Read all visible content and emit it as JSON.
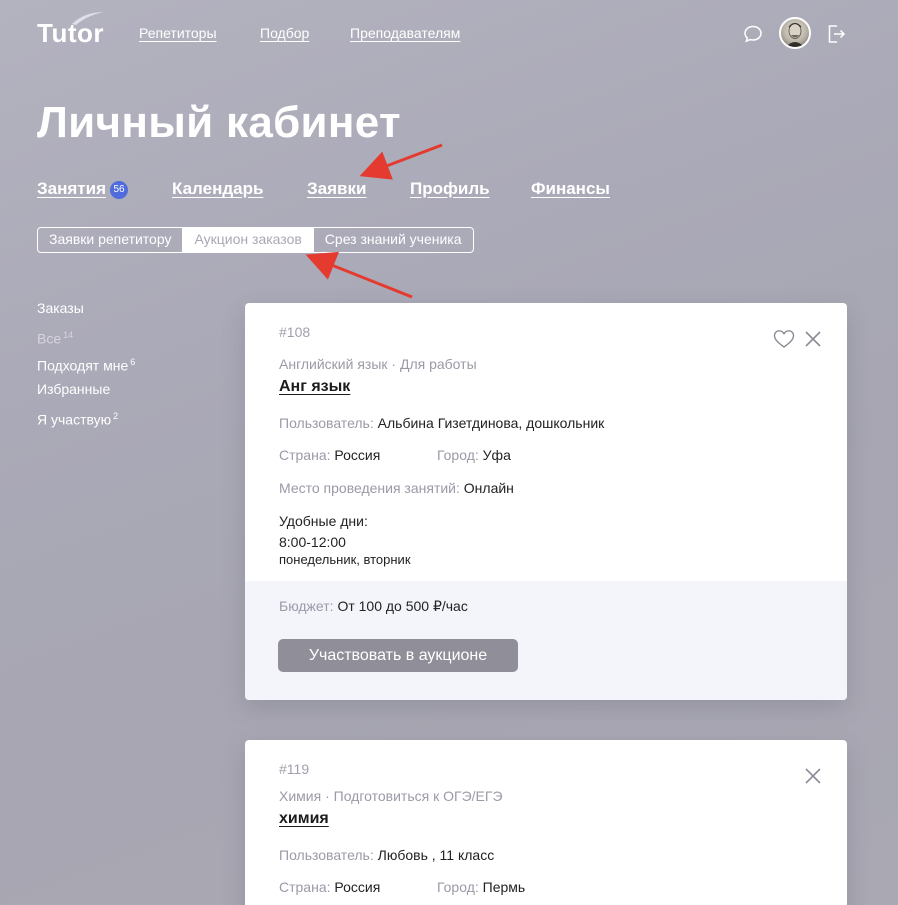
{
  "header": {
    "logo": "Tutor",
    "nav": [
      "Репетиторы",
      "Подбор",
      "Преподавателям"
    ],
    "icons": [
      "chat-icon",
      "avatar",
      "logout-icon"
    ]
  },
  "page": {
    "title": "Личный кабинет"
  },
  "main_tabs": [
    {
      "label": "Занятия",
      "badge": "56"
    },
    {
      "label": "Календарь"
    },
    {
      "label": "Заявки"
    },
    {
      "label": "Профиль"
    },
    {
      "label": "Финансы"
    }
  ],
  "sub_tabs": [
    {
      "label": "Заявки репетитору",
      "active": false
    },
    {
      "label": "Аукцион заказов",
      "active": true
    },
    {
      "label": "Срез знаний ученика",
      "active": false
    }
  ],
  "sidebar": {
    "heading": "Заказы",
    "items": [
      {
        "label": "Все",
        "count": "14"
      },
      {
        "label": "Подходят мне",
        "count": "6"
      },
      {
        "label": "Избранные",
        "count": ""
      },
      {
        "label": "Я участвую",
        "count": "2"
      }
    ]
  },
  "orders": [
    {
      "id": "#108",
      "subject": "Английский язык · Для работы",
      "title": "Анг язык",
      "user_label": "Пользователь:",
      "user": "Альбина Гизетдинова, дошкольник",
      "country_label": "Страна:",
      "country": "Россия",
      "city_label": "Город:",
      "city": "Уфа",
      "place_label": "Место проведения занятий:",
      "place": "Онлайн",
      "days_label": "Удобные дни:",
      "time": "8:00-12:00",
      "days": "понедельник, вторник",
      "budget_label": "Бюджет:",
      "budget": "От 100 до 500 ₽/час",
      "button": "Участвовать в аукционе"
    },
    {
      "id": "#119",
      "subject": "Химия · Подготовиться к ОГЭ/ЕГЭ",
      "title": "химия",
      "user_label": "Пользователь:",
      "user": "Любовь , 11 класс",
      "country_label": "Страна:",
      "country": "Россия",
      "city_label": "Город:",
      "city": "Пермь"
    }
  ],
  "colors": {
    "accent_badge": "#4f6bdc",
    "arrow": "#e53a2f",
    "button": "#8f8e99"
  }
}
